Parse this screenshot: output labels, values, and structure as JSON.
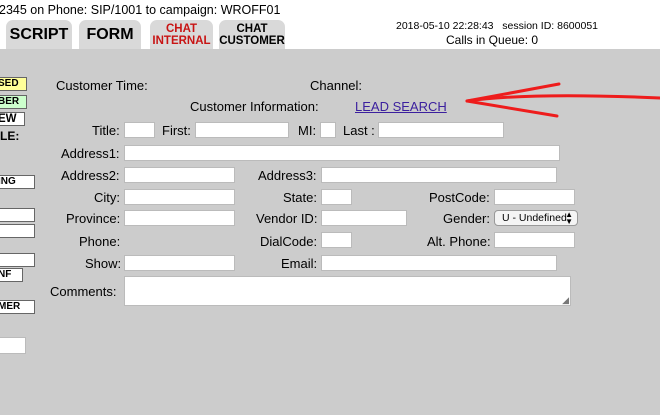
{
  "header": {
    "phone_info": "2345 on Phone: SIP/1001  to campaign: WROFF01",
    "timestamp": "2018-05-10 22:28:43",
    "session": "session ID: 8600051",
    "calls_in_queue": "Calls in Queue: 0"
  },
  "tabs": [
    {
      "label": "SCRIPT"
    },
    {
      "label": "FORM"
    },
    {
      "line1": "CHAT",
      "line2": "INTERNAL"
    },
    {
      "line1": "CHAT",
      "line2": "CUSTOMER"
    }
  ],
  "sidebar": {
    "b1": "SED",
    "b2": "BER",
    "b3": "EW",
    "t1": "LE:",
    "b4": "ING",
    "b5": "NF",
    "b6": "MER"
  },
  "form": {
    "customer_time_label": "Customer Time:",
    "channel_label": "Channel:",
    "customer_info_label": "Customer Information:",
    "lead_search_link": "LEAD SEARCH",
    "title_label": "Title:",
    "first_label": "First:",
    "mi_label": "MI:",
    "last_label": "Last :",
    "address1_label": "Address1:",
    "address2_label": "Address2:",
    "address3_label": "Address3:",
    "city_label": "City:",
    "state_label": "State:",
    "postcode_label": "PostCode:",
    "province_label": "Province:",
    "vendor_id_label": "Vendor ID:",
    "gender_label": "Gender:",
    "gender_value": "U - Undefined",
    "phone_label": "Phone:",
    "dialcode_label": "DialCode:",
    "alt_phone_label": "Alt. Phone:",
    "show_label": "Show:",
    "email_label": "Email:",
    "comments_label": "Comments:"
  },
  "colors": {
    "arrow": "#ee1c1c",
    "panel_bg": "#cccccc",
    "tab_bg": "#d9d9d9",
    "chat_tab_text": "#c81414",
    "button_yellow": "#ffff99",
    "button_green": "#ccffcc",
    "link": "#3b1f9e"
  }
}
